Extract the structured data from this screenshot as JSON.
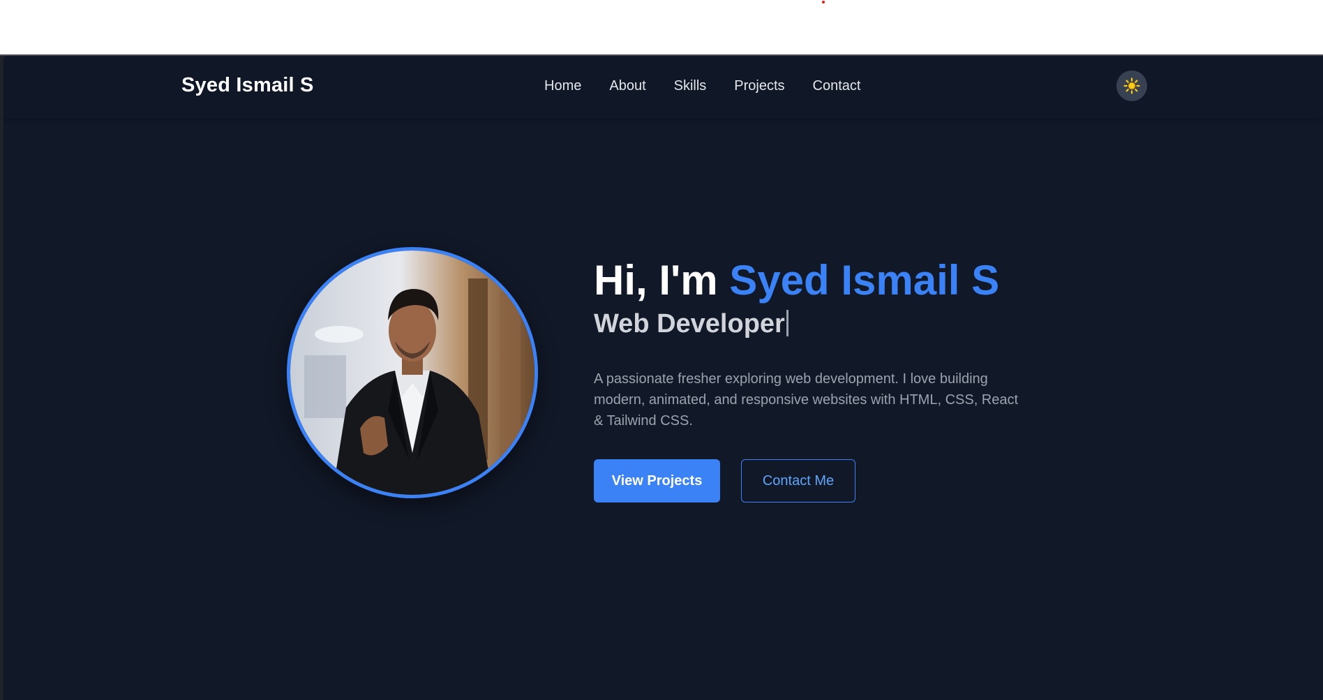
{
  "colors": {
    "background": "#111827",
    "accent": "#3b82f6",
    "text_primary": "#ffffff",
    "text_muted": "#9ca3af"
  },
  "navbar": {
    "brand": "Syed Ismail S",
    "links": [
      {
        "label": "Home"
      },
      {
        "label": "About"
      },
      {
        "label": "Skills"
      },
      {
        "label": "Projects"
      },
      {
        "label": "Contact"
      }
    ],
    "theme_toggle_icon": "sun-icon"
  },
  "hero": {
    "greeting": "Hi, I'm ",
    "name": "Syed Ismail S",
    "role": "Web Developer",
    "description": "A passionate fresher exploring web development. I love building modern, animated, and responsive websites with HTML, CSS, React & Tailwind CSS.",
    "buttons": {
      "primary": "View Projects",
      "secondary": "Contact Me"
    },
    "photo_icon": "profile-photo"
  }
}
